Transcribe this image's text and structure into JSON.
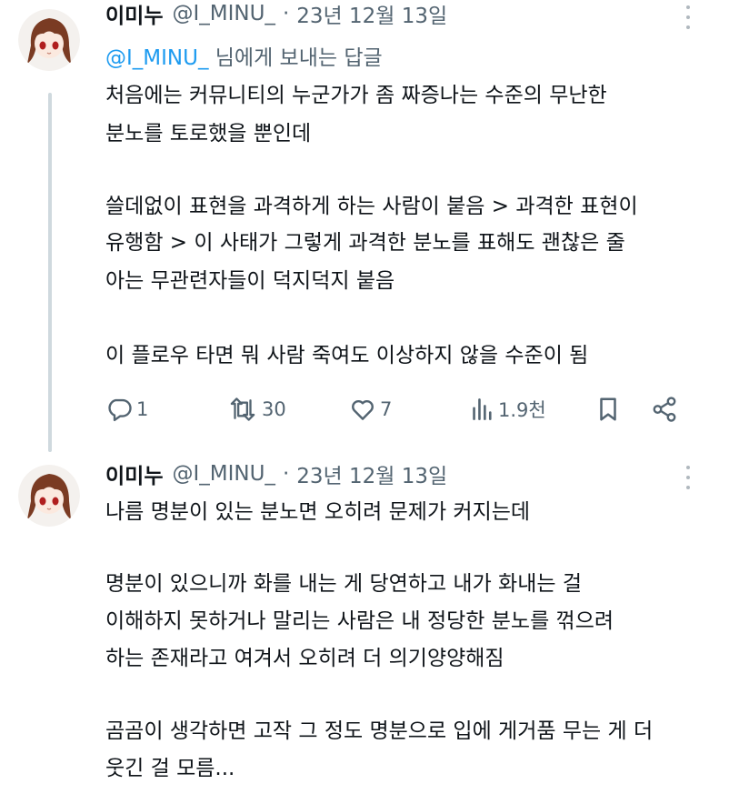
{
  "colors": {
    "accent": "#1d9bf0",
    "text": "#0f1419",
    "muted": "#536471",
    "thread_line": "#cfd9de"
  },
  "tweets": [
    {
      "avatar": "avatar-anime-character",
      "name": "이미누",
      "handle": "@I_MINU_",
      "dot": "·",
      "date": "23년 12월 13일",
      "reply_to": {
        "mention": "@I_MINU_",
        "suffix": " 님에게 보내는 답글"
      },
      "lines": [
        "처음에는 커뮤니티의 누군가가 좀 짜증나는 수준의 무난한",
        "분노를 토로했을 뿐인데",
        "쓸데없이 표현을 과격하게 하는 사람이 붙음 > 과격한 표현이",
        "유행함 > 이 사태가 그렇게 과격한 분노를 표해도 괜찮은 줄",
        "아는 무관련자들이 덕지덕지 붙음",
        "이 플로우 타면 뭐 사람 죽여도 이상하지 않을 수준이 됨"
      ],
      "actions": {
        "replies": "1",
        "retweets": "30",
        "likes": "7",
        "views": "1.9천"
      }
    },
    {
      "avatar": "avatar-anime-character",
      "name": "이미누",
      "handle": "@I_MINU_",
      "dot": "·",
      "date": "23년 12월 13일",
      "lines": [
        "나름 명분이 있는 분노면 오히려 문제가 커지는데",
        "명분이 있으니까 화를 내는 게 당연하고 내가 화내는 걸",
        "이해하지 못하거나 말리는 사람은 내 정당한 분노를 꺾으려",
        "하는 존재라고 여겨서 오히려 더 의기양양해짐",
        "곰곰이 생각하면 고작 그 정도 명분으로 입에 게거품 무는 게 더",
        "웃긴 걸 모름..."
      ]
    }
  ]
}
